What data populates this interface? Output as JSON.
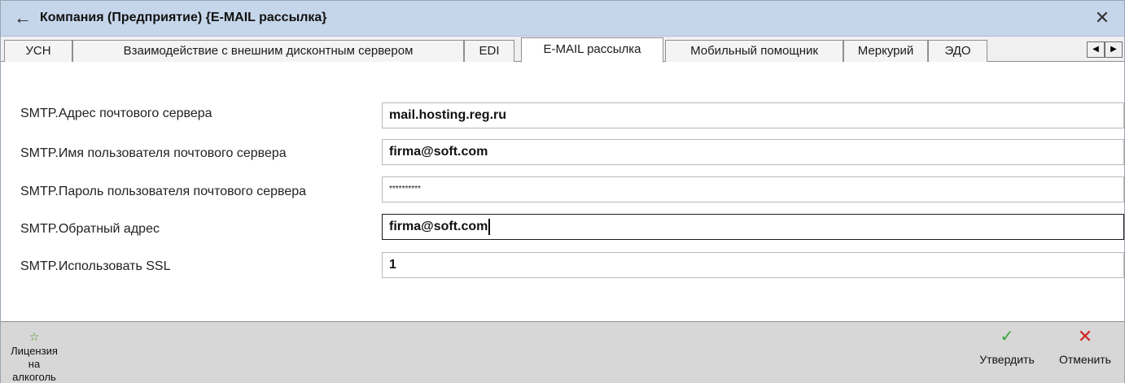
{
  "window": {
    "title": "Компания (Предприятие) {E-MAIL рассылка}",
    "back_icon": "←",
    "close_icon": "✕"
  },
  "tabs": [
    {
      "label": "УСН",
      "active": false
    },
    {
      "label": "Взаимодействие с внешним дисконтным сервером",
      "active": false
    },
    {
      "label": "EDI",
      "active": false
    },
    {
      "label": "E-MAIL рассылка",
      "active": true
    },
    {
      "label": "Мобильный помощник",
      "active": false
    },
    {
      "label": "Меркурий",
      "active": false
    },
    {
      "label": "ЭДО",
      "active": false
    }
  ],
  "tab_scroll": {
    "left": "◀",
    "right": "▶"
  },
  "form": {
    "rows": [
      {
        "label": "SMTP.Адрес почтового сервера",
        "value": "mail.hosting.reg.ru"
      },
      {
        "label": "SMTP.Имя пользователя почтового сервера",
        "value": "firma@soft.com"
      },
      {
        "label": "SMTP.Пароль пользователя почтового сервера",
        "value": "**********"
      },
      {
        "label": "SMTP.Обратный адрес",
        "value": "firma@soft.com"
      },
      {
        "label": "SMTP.Использовать SSL",
        "value": "1"
      }
    ]
  },
  "toolbar": {
    "license_label_1": "Лицензия на",
    "license_label_2": "алкоголь",
    "approve_label": "Утвердить",
    "cancel_label": "Отменить"
  },
  "colors": {
    "titlebar": "#c6d6ea",
    "approve": "#33a533",
    "cancel": "#d12020"
  }
}
